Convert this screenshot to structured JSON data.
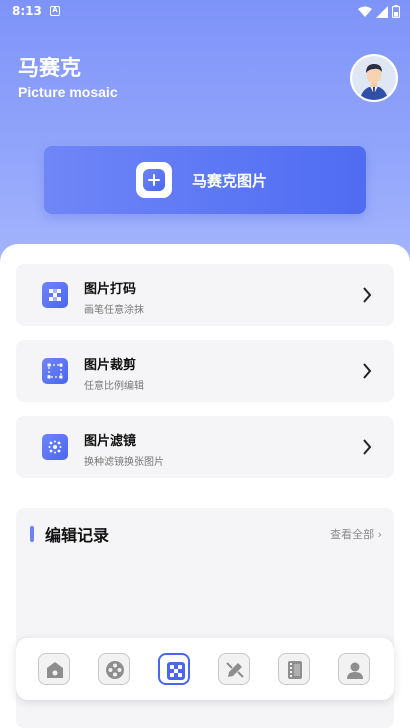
{
  "status": {
    "time": "8:13",
    "notice_glyph": "A"
  },
  "header": {
    "title": "马赛克",
    "subtitle": "Picture mosaic"
  },
  "main_action": {
    "label": "马赛克图片"
  },
  "tools": [
    {
      "title": "图片打码",
      "desc": "画笔任意涂抹",
      "icon": "mosaic-grid-icon"
    },
    {
      "title": "图片裁剪",
      "desc": "任意比例编辑",
      "icon": "crop-icon"
    },
    {
      "title": "图片滤镜",
      "desc": "换种滤镜换张图片",
      "icon": "filter-icon"
    }
  ],
  "history": {
    "title": "编辑记录",
    "view_all": "查看全部 ›"
  },
  "tabbar": {
    "items": [
      {
        "icon": "home-icon",
        "active": false
      },
      {
        "icon": "film-reel-icon",
        "active": false
      },
      {
        "icon": "mosaic-icon",
        "active": true
      },
      {
        "icon": "pencil-icon",
        "active": false
      },
      {
        "icon": "film-strip-icon",
        "active": false
      },
      {
        "icon": "person-icon",
        "active": false
      }
    ]
  },
  "colors": {
    "accent": "#4a66f0",
    "hero_top": "#7e93f9",
    "card_bg": "#f5f5f7"
  }
}
